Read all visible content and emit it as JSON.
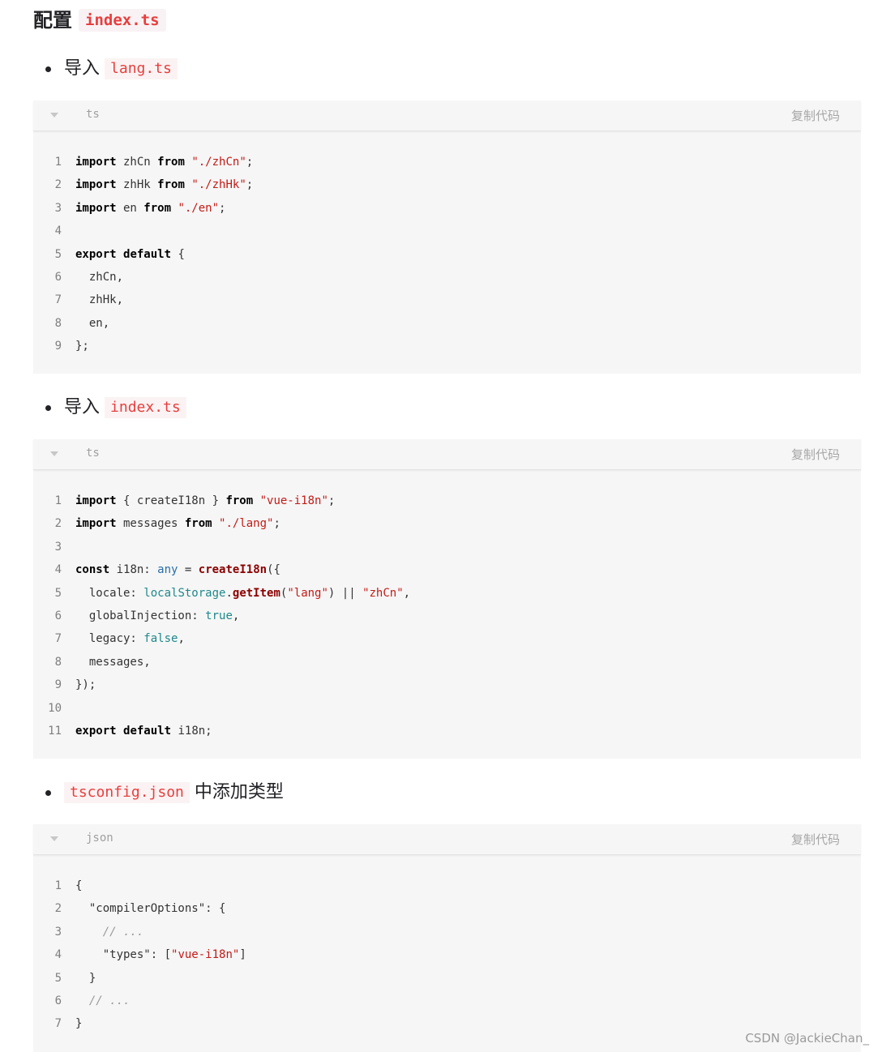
{
  "heading": {
    "prefix": "配置",
    "code": "index.ts"
  },
  "bullets": [
    {
      "text": "导入",
      "code": "lang.ts"
    },
    {
      "text": "导入",
      "code": "index.ts"
    },
    {
      "code": "tsconfig.json",
      "text": "中添加类型"
    }
  ],
  "copy_label": "复制代码",
  "blocks": [
    {
      "lang": "ts",
      "lines": [
        [
          [
            "kw",
            "import"
          ],
          [
            "pl",
            " zhCn "
          ],
          [
            "kw",
            "from"
          ],
          [
            "pl",
            " "
          ],
          [
            "str",
            "\"./zhCn\""
          ],
          [
            "pl",
            ";"
          ]
        ],
        [
          [
            "kw",
            "import"
          ],
          [
            "pl",
            " zhHk "
          ],
          [
            "kw",
            "from"
          ],
          [
            "pl",
            " "
          ],
          [
            "str",
            "\"./zhHk\""
          ],
          [
            "pl",
            ";"
          ]
        ],
        [
          [
            "kw",
            "import"
          ],
          [
            "pl",
            " en "
          ],
          [
            "kw",
            "from"
          ],
          [
            "pl",
            " "
          ],
          [
            "str",
            "\"./en\""
          ],
          [
            "pl",
            ";"
          ]
        ],
        [],
        [
          [
            "kw",
            "export"
          ],
          [
            "pl",
            " "
          ],
          [
            "kw",
            "default"
          ],
          [
            "pl",
            " {"
          ]
        ],
        [
          [
            "pl",
            "  zhCn,"
          ]
        ],
        [
          [
            "pl",
            "  zhHk,"
          ]
        ],
        [
          [
            "pl",
            "  en,"
          ]
        ],
        [
          [
            "pl",
            "};"
          ]
        ]
      ]
    },
    {
      "lang": "ts",
      "lines": [
        [
          [
            "kw",
            "import"
          ],
          [
            "pl",
            " { createI18n } "
          ],
          [
            "kw",
            "from"
          ],
          [
            "pl",
            " "
          ],
          [
            "str",
            "\"vue-i18n\""
          ],
          [
            "pl",
            ";"
          ]
        ],
        [
          [
            "kw",
            "import"
          ],
          [
            "pl",
            " messages "
          ],
          [
            "kw",
            "from"
          ],
          [
            "pl",
            " "
          ],
          [
            "str",
            "\"./lang\""
          ],
          [
            "pl",
            ";"
          ]
        ],
        [],
        [
          [
            "kw",
            "const"
          ],
          [
            "pl",
            " i18n: "
          ],
          [
            "ty",
            "any"
          ],
          [
            "pl",
            " = "
          ],
          [
            "fn",
            "createI18n"
          ],
          [
            "pl",
            "({"
          ]
        ],
        [
          [
            "pl",
            "  locale: "
          ],
          [
            "bi",
            "localStorage"
          ],
          [
            "pl",
            "."
          ],
          [
            "fn",
            "getItem"
          ],
          [
            "pl",
            "("
          ],
          [
            "str",
            "\"lang\""
          ],
          [
            "pl",
            ") || "
          ],
          [
            "str",
            "\"zhCn\""
          ],
          [
            "pl",
            ","
          ]
        ],
        [
          [
            "pl",
            "  globalInjection: "
          ],
          [
            "bi",
            "true"
          ],
          [
            "pl",
            ","
          ]
        ],
        [
          [
            "pl",
            "  legacy: "
          ],
          [
            "bi",
            "false"
          ],
          [
            "pl",
            ","
          ]
        ],
        [
          [
            "pl",
            "  messages,"
          ]
        ],
        [
          [
            "pl",
            "});"
          ]
        ],
        [],
        [
          [
            "kw",
            "export"
          ],
          [
            "pl",
            " "
          ],
          [
            "kw",
            "default"
          ],
          [
            "pl",
            " i18n;"
          ]
        ]
      ]
    },
    {
      "lang": "json",
      "lines": [
        [
          [
            "pl",
            "{"
          ]
        ],
        [
          [
            "pl",
            "  \"compilerOptions\": {"
          ]
        ],
        [
          [
            "pl",
            "    "
          ],
          [
            "cm",
            "// ..."
          ]
        ],
        [
          [
            "pl",
            "    \"types\": ["
          ],
          [
            "str",
            "\"vue-i18n\""
          ],
          [
            "pl",
            "]"
          ]
        ],
        [
          [
            "pl",
            "  }"
          ]
        ],
        [
          [
            "pl",
            "  "
          ],
          [
            "cm",
            "// ..."
          ]
        ],
        [
          [
            "pl",
            "}"
          ]
        ]
      ]
    }
  ],
  "watermark": "CSDN @JackieChan_"
}
